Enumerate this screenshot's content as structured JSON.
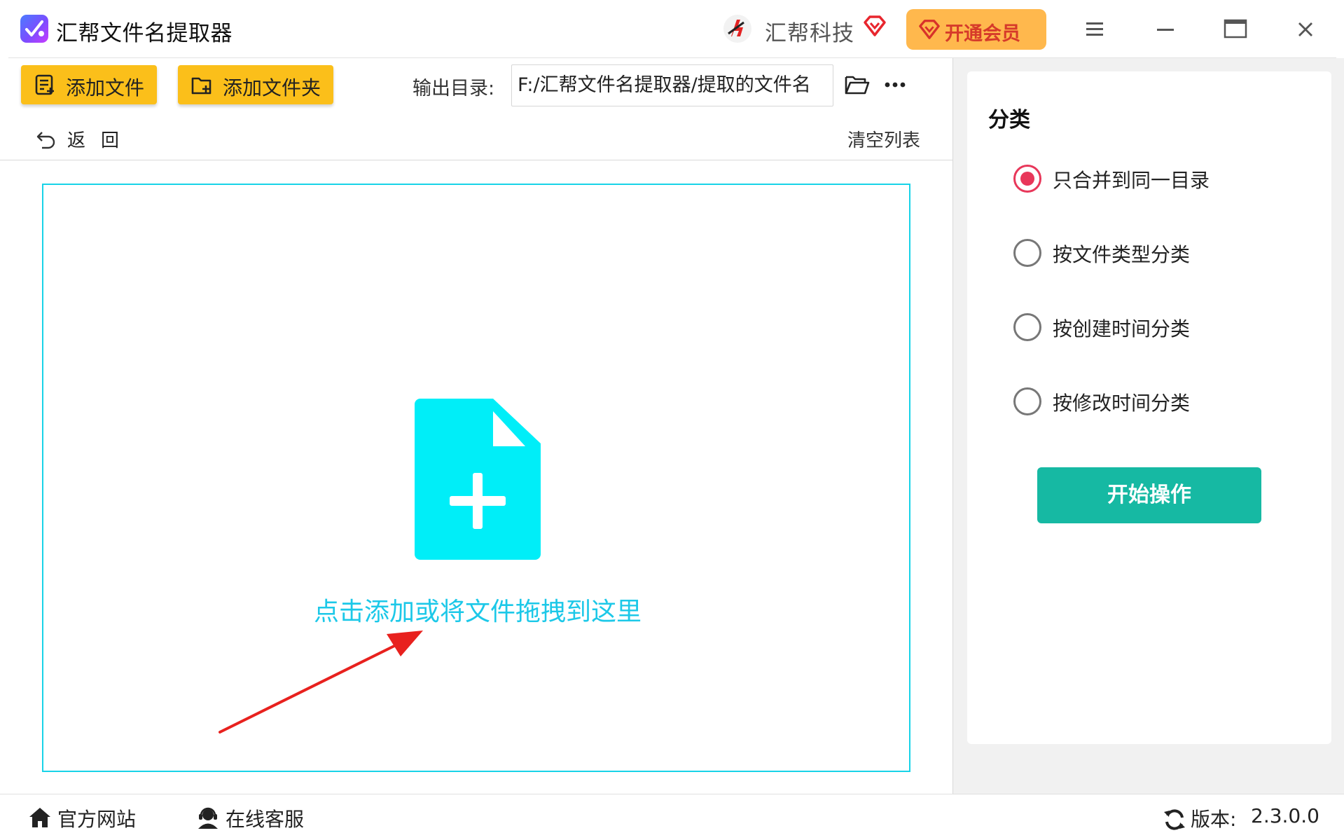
{
  "app": {
    "title": "汇帮文件名提取器",
    "brand_name": "汇帮科技",
    "vip_label": "开通会员"
  },
  "toolbar": {
    "add_file_label": "添加文件",
    "add_folder_label": "添加文件夹",
    "output_label": "输出目录:",
    "output_path": "F:/汇帮文件名提取器/提取的文件名",
    "back_label": "返回",
    "clear_label": "清空列表"
  },
  "drop_zone": {
    "hint": "点击添加或将文件拖拽到这里"
  },
  "classification": {
    "title": "分类",
    "options": [
      {
        "label": "只合并到同一目录",
        "selected": true
      },
      {
        "label": "按文件类型分类",
        "selected": false
      },
      {
        "label": "按创建时间分类",
        "selected": false
      },
      {
        "label": "按修改时间分类",
        "selected": false
      }
    ],
    "start_label": "开始操作"
  },
  "status_bar": {
    "website_label": "官方网站",
    "service_label": "在线客服",
    "version_label": "版本:",
    "version_value": "2.3.0.0"
  },
  "colors": {
    "accent_yellow": "#fbbf1a",
    "drop_border": "#18d3e8",
    "drop_icon": "#00eef8",
    "hint_text": "#1cc8e8",
    "radio_selected": "#e8375a",
    "start_button": "#16b9a3",
    "vip_button": "#ffb84d"
  }
}
